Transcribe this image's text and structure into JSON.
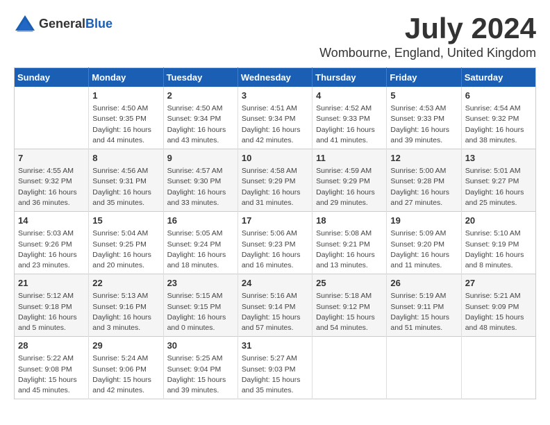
{
  "header": {
    "logo_general": "General",
    "logo_blue": "Blue",
    "month": "July 2024",
    "location": "Wombourne, England, United Kingdom"
  },
  "days_of_week": [
    "Sunday",
    "Monday",
    "Tuesday",
    "Wednesday",
    "Thursday",
    "Friday",
    "Saturday"
  ],
  "weeks": [
    [
      {
        "day": "",
        "info": ""
      },
      {
        "day": "1",
        "info": "Sunrise: 4:50 AM\nSunset: 9:35 PM\nDaylight: 16 hours\nand 44 minutes."
      },
      {
        "day": "2",
        "info": "Sunrise: 4:50 AM\nSunset: 9:34 PM\nDaylight: 16 hours\nand 43 minutes."
      },
      {
        "day": "3",
        "info": "Sunrise: 4:51 AM\nSunset: 9:34 PM\nDaylight: 16 hours\nand 42 minutes."
      },
      {
        "day": "4",
        "info": "Sunrise: 4:52 AM\nSunset: 9:33 PM\nDaylight: 16 hours\nand 41 minutes."
      },
      {
        "day": "5",
        "info": "Sunrise: 4:53 AM\nSunset: 9:33 PM\nDaylight: 16 hours\nand 39 minutes."
      },
      {
        "day": "6",
        "info": "Sunrise: 4:54 AM\nSunset: 9:32 PM\nDaylight: 16 hours\nand 38 minutes."
      }
    ],
    [
      {
        "day": "7",
        "info": "Sunrise: 4:55 AM\nSunset: 9:32 PM\nDaylight: 16 hours\nand 36 minutes."
      },
      {
        "day": "8",
        "info": "Sunrise: 4:56 AM\nSunset: 9:31 PM\nDaylight: 16 hours\nand 35 minutes."
      },
      {
        "day": "9",
        "info": "Sunrise: 4:57 AM\nSunset: 9:30 PM\nDaylight: 16 hours\nand 33 minutes."
      },
      {
        "day": "10",
        "info": "Sunrise: 4:58 AM\nSunset: 9:29 PM\nDaylight: 16 hours\nand 31 minutes."
      },
      {
        "day": "11",
        "info": "Sunrise: 4:59 AM\nSunset: 9:29 PM\nDaylight: 16 hours\nand 29 minutes."
      },
      {
        "day": "12",
        "info": "Sunrise: 5:00 AM\nSunset: 9:28 PM\nDaylight: 16 hours\nand 27 minutes."
      },
      {
        "day": "13",
        "info": "Sunrise: 5:01 AM\nSunset: 9:27 PM\nDaylight: 16 hours\nand 25 minutes."
      }
    ],
    [
      {
        "day": "14",
        "info": "Sunrise: 5:03 AM\nSunset: 9:26 PM\nDaylight: 16 hours\nand 23 minutes."
      },
      {
        "day": "15",
        "info": "Sunrise: 5:04 AM\nSunset: 9:25 PM\nDaylight: 16 hours\nand 20 minutes."
      },
      {
        "day": "16",
        "info": "Sunrise: 5:05 AM\nSunset: 9:24 PM\nDaylight: 16 hours\nand 18 minutes."
      },
      {
        "day": "17",
        "info": "Sunrise: 5:06 AM\nSunset: 9:23 PM\nDaylight: 16 hours\nand 16 minutes."
      },
      {
        "day": "18",
        "info": "Sunrise: 5:08 AM\nSunset: 9:21 PM\nDaylight: 16 hours\nand 13 minutes."
      },
      {
        "day": "19",
        "info": "Sunrise: 5:09 AM\nSunset: 9:20 PM\nDaylight: 16 hours\nand 11 minutes."
      },
      {
        "day": "20",
        "info": "Sunrise: 5:10 AM\nSunset: 9:19 PM\nDaylight: 16 hours\nand 8 minutes."
      }
    ],
    [
      {
        "day": "21",
        "info": "Sunrise: 5:12 AM\nSunset: 9:18 PM\nDaylight: 16 hours\nand 5 minutes."
      },
      {
        "day": "22",
        "info": "Sunrise: 5:13 AM\nSunset: 9:16 PM\nDaylight: 16 hours\nand 3 minutes."
      },
      {
        "day": "23",
        "info": "Sunrise: 5:15 AM\nSunset: 9:15 PM\nDaylight: 16 hours\nand 0 minutes."
      },
      {
        "day": "24",
        "info": "Sunrise: 5:16 AM\nSunset: 9:14 PM\nDaylight: 15 hours\nand 57 minutes."
      },
      {
        "day": "25",
        "info": "Sunrise: 5:18 AM\nSunset: 9:12 PM\nDaylight: 15 hours\nand 54 minutes."
      },
      {
        "day": "26",
        "info": "Sunrise: 5:19 AM\nSunset: 9:11 PM\nDaylight: 15 hours\nand 51 minutes."
      },
      {
        "day": "27",
        "info": "Sunrise: 5:21 AM\nSunset: 9:09 PM\nDaylight: 15 hours\nand 48 minutes."
      }
    ],
    [
      {
        "day": "28",
        "info": "Sunrise: 5:22 AM\nSunset: 9:08 PM\nDaylight: 15 hours\nand 45 minutes."
      },
      {
        "day": "29",
        "info": "Sunrise: 5:24 AM\nSunset: 9:06 PM\nDaylight: 15 hours\nand 42 minutes."
      },
      {
        "day": "30",
        "info": "Sunrise: 5:25 AM\nSunset: 9:04 PM\nDaylight: 15 hours\nand 39 minutes."
      },
      {
        "day": "31",
        "info": "Sunrise: 5:27 AM\nSunset: 9:03 PM\nDaylight: 15 hours\nand 35 minutes."
      },
      {
        "day": "",
        "info": ""
      },
      {
        "day": "",
        "info": ""
      },
      {
        "day": "",
        "info": ""
      }
    ]
  ]
}
